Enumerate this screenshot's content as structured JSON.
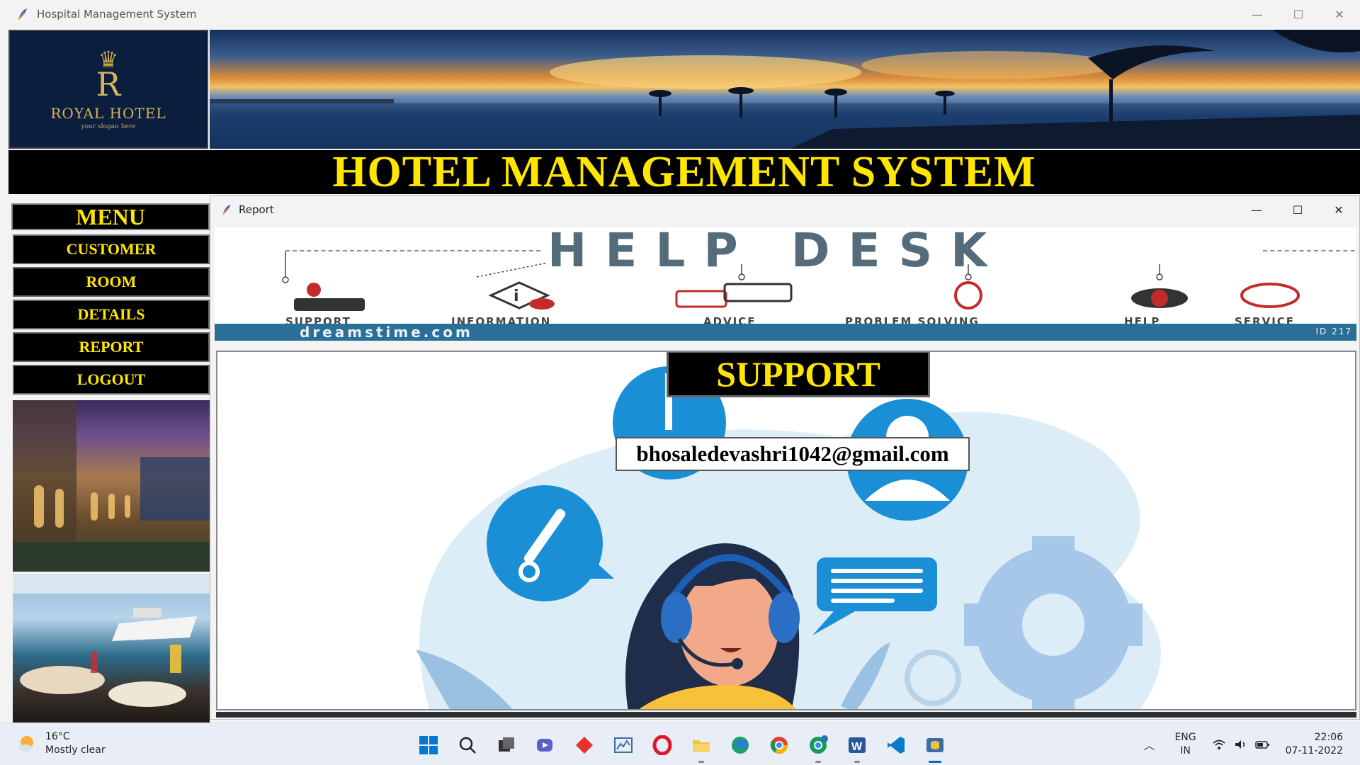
{
  "main_window": {
    "title": "Hospital Management System",
    "controls": {
      "minimize": "—",
      "maximize": "☐",
      "close": "✕"
    }
  },
  "logo": {
    "letter": "R",
    "brand": "ROYAL HOTEL",
    "slogan": "your slogan here"
  },
  "header": {
    "title": "HOTEL MANAGEMENT SYSTEM"
  },
  "menu": {
    "heading": "MENU",
    "items": [
      {
        "label": "CUSTOMER"
      },
      {
        "label": "ROOM"
      },
      {
        "label": "DETAILS"
      },
      {
        "label": "REPORT"
      },
      {
        "label": "LOGOUT"
      }
    ]
  },
  "report_window": {
    "title": "Report",
    "controls": {
      "minimize": "—",
      "maximize": "☐",
      "close": "✕"
    },
    "help_desk": {
      "title": "HELP DESK",
      "items": [
        "SUPPORT",
        "INFORMATION",
        "ADVICE",
        "PROBLEM SOLVING",
        "HELP",
        "SERVICE"
      ],
      "watermark": "dreamstime.com",
      "id_text": "ID 217"
    },
    "support": {
      "title": "SUPPORT",
      "email": "bhosaledevashri1042@gmail.com"
    }
  },
  "taskbar": {
    "weather": {
      "temp": "16°C",
      "condition": "Mostly clear"
    },
    "apps": [
      {
        "name": "start-icon"
      },
      {
        "name": "search-icon"
      },
      {
        "name": "task-view-icon"
      },
      {
        "name": "teams-chat-icon"
      },
      {
        "name": "app-diamond-icon"
      },
      {
        "name": "chart-app-icon"
      },
      {
        "name": "opera-icon"
      },
      {
        "name": "file-explorer-icon"
      },
      {
        "name": "edge-icon"
      },
      {
        "name": "chrome-icon"
      },
      {
        "name": "chrome-profile-icon"
      },
      {
        "name": "word-icon"
      },
      {
        "name": "vscode-icon"
      },
      {
        "name": "python-app-icon"
      }
    ],
    "language": {
      "line1": "ENG",
      "line2": "IN"
    },
    "clock": {
      "time": "22:06",
      "date": "07-11-2022"
    }
  },
  "colors": {
    "menu_text": "#ffe600",
    "menu_bg": "#000000",
    "support_blue": "#1a8fd6",
    "support_light": "#dcedf8"
  }
}
